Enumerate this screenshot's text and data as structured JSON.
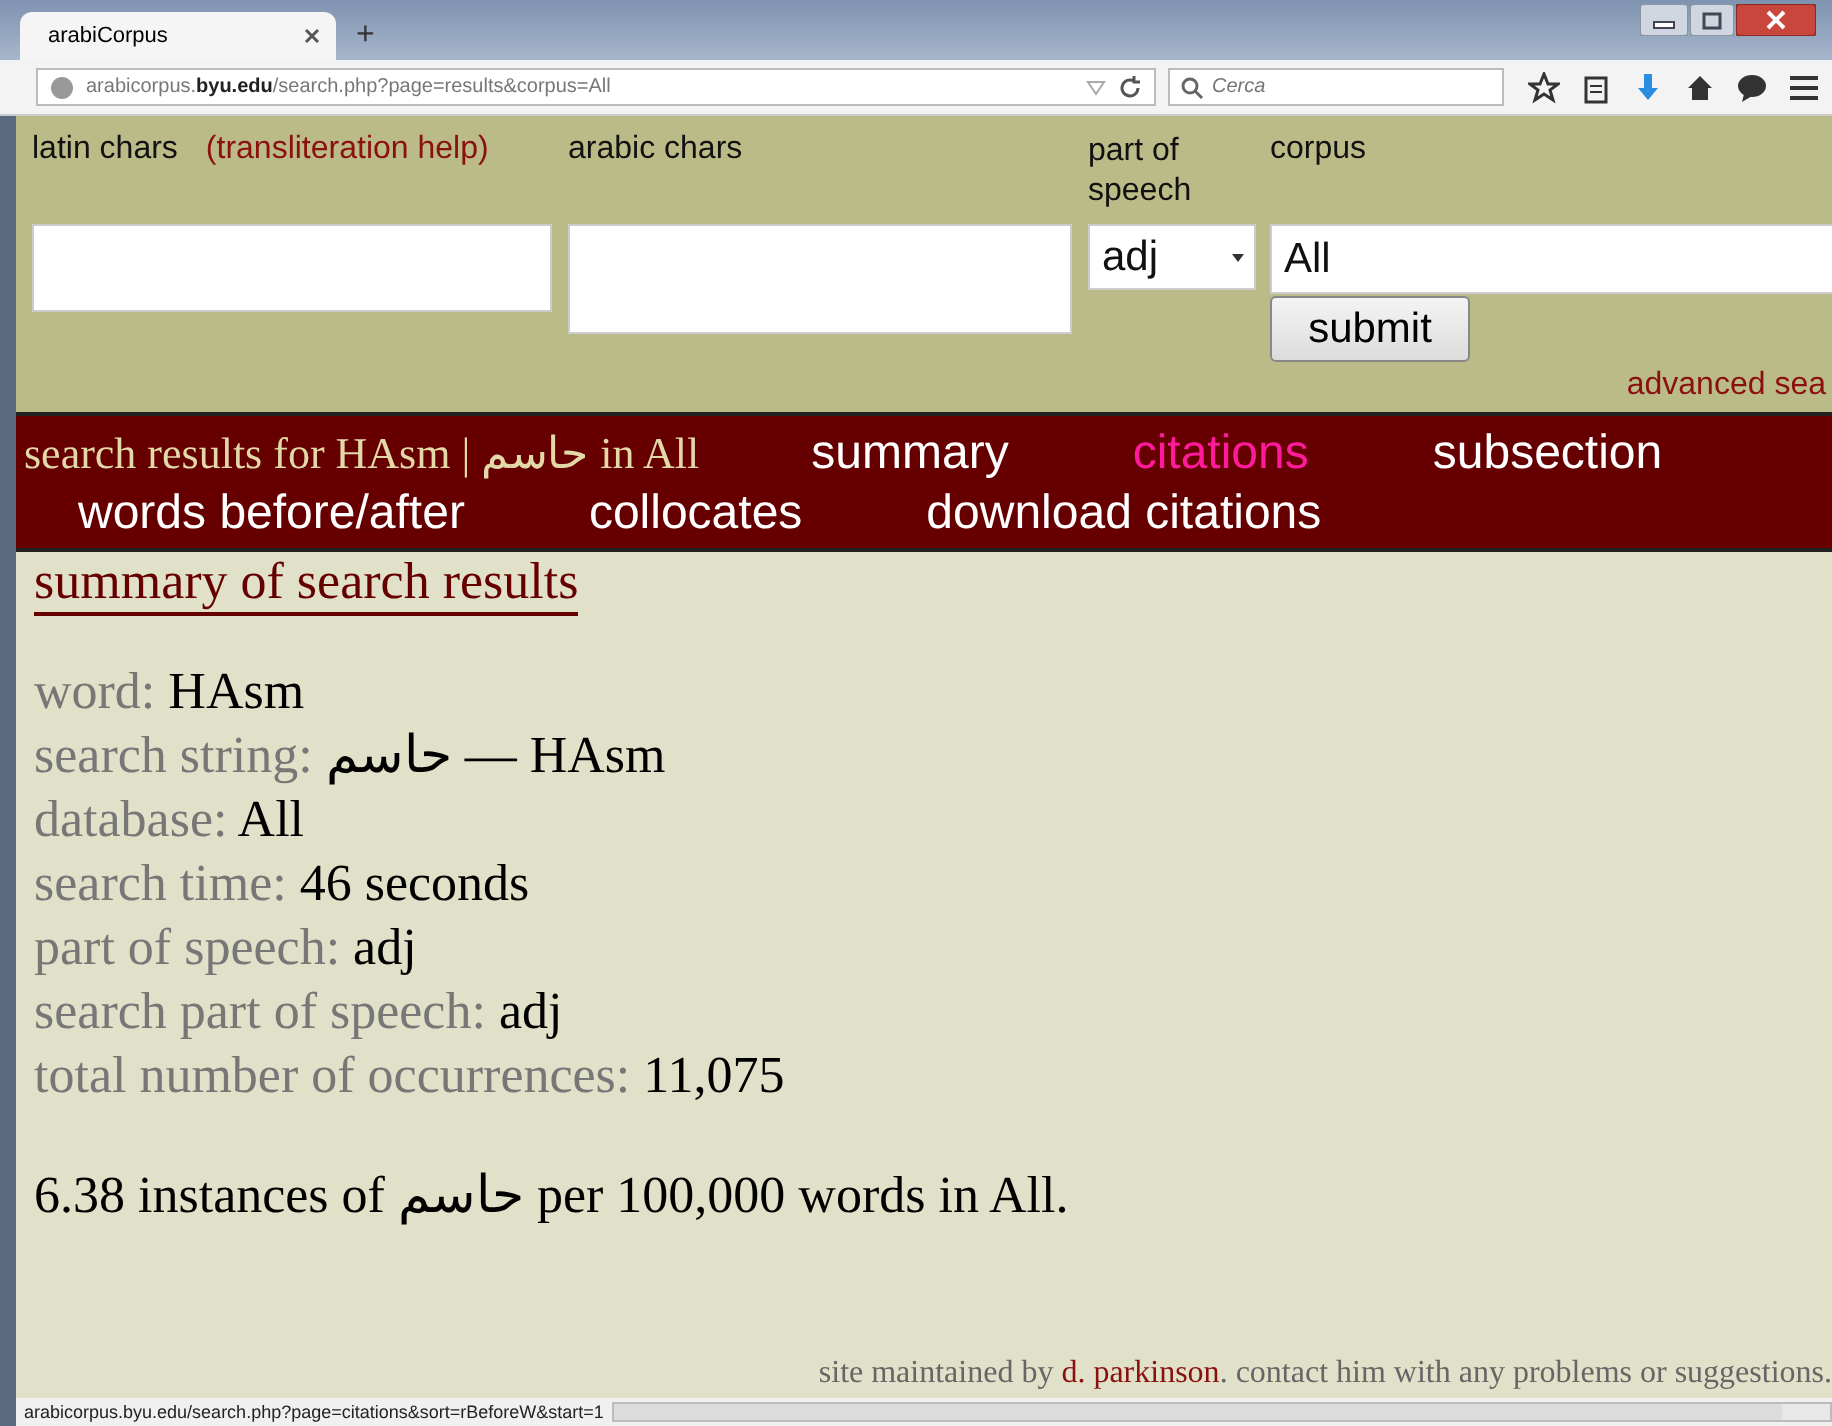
{
  "browser": {
    "tab_title": "arabiCorpus",
    "new_tab": "+",
    "url_host_prefix": "arabicorpus.",
    "url_host": "byu.edu",
    "url_path": "/search.php?page=results&corpus=All",
    "search_placeholder": "Cerca",
    "status_url": "arabicorpus.byu.edu/search.php?page=citations&sort=rBeforeW&start=1"
  },
  "form": {
    "latin_label": "latin chars",
    "help_link": "(transliteration help)",
    "arabic_label": "arabic chars",
    "pos_label": "part of speech",
    "pos_value": "adj",
    "corpus_label": "corpus",
    "corpus_value": "All",
    "submit": "submit",
    "advanced_link": "advanced sea"
  },
  "nav": {
    "title": "search results for HAsm | حاسم in All",
    "links": [
      {
        "label": "summary",
        "selected": false
      },
      {
        "label": "citations",
        "selected": true
      },
      {
        "label": "subsection",
        "selected": false
      },
      {
        "label": "words before/after",
        "selected": false
      },
      {
        "label": "collocates",
        "selected": false
      },
      {
        "label": "download citations",
        "selected": false
      }
    ]
  },
  "summary": {
    "heading": "summary of search results",
    "rows": [
      {
        "label": "word:",
        "value": "HAsm"
      },
      {
        "label": "search string:",
        "value": "حاسم — HAsm"
      },
      {
        "label": "database:",
        "value": "All"
      },
      {
        "label": "search time:",
        "value": "46 seconds"
      },
      {
        "label": "part of speech:",
        "value": "adj"
      },
      {
        "label": "search part of speech:",
        "value": "adj"
      },
      {
        "label": "total number of occurrences:",
        "value": "11,075"
      }
    ],
    "instances": "6.38 instances of حاسم per 100,000 words in All."
  },
  "footer": {
    "before": "site maintained by",
    "link": "d. parkinson",
    "after": ". contact him with any problems or suggestions."
  }
}
